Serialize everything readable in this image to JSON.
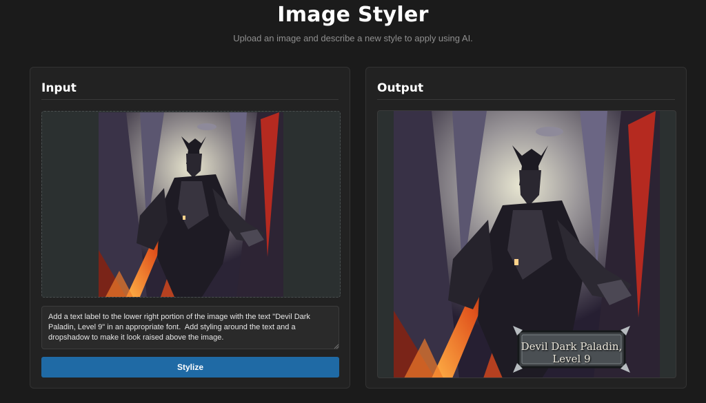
{
  "header": {
    "title": "Image Styler",
    "subtitle": "Upload an image and describe a new style to apply using AI."
  },
  "input_panel": {
    "title": "Input",
    "prompt_value": "Add a text label to the lower right portion of the image with the text \"Devil Dark Paladin, Level 9\" in an appropriate font.  Add styling around the text and a dropshadow to make it look raised above the image.",
    "button_label": "Stylize"
  },
  "output_panel": {
    "title": "Output",
    "label_line1": "Devil Dark Paladin,",
    "label_line2": "Level 9"
  },
  "colors": {
    "background": "#1b1b1b",
    "panel": "#222222",
    "accent_button": "#1f6aa5",
    "dropzone": "#2b3030"
  }
}
